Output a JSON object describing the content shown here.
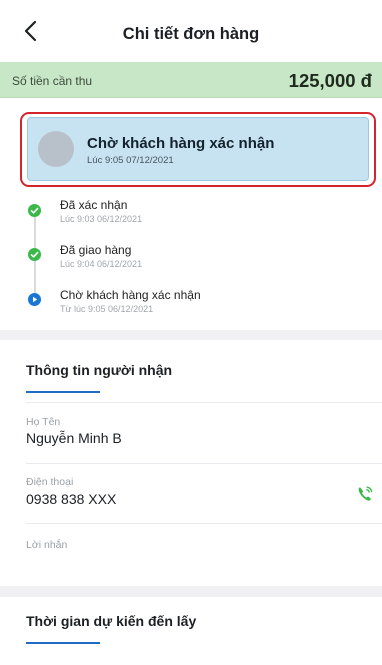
{
  "header": {
    "title": "Chi tiết đơn hàng"
  },
  "amount": {
    "label": "Số tiền cần thu",
    "value": "125,000 đ"
  },
  "current_status": {
    "title": "Chờ khách hàng xác nhận",
    "time": "Lúc 9:05 07/12/2021"
  },
  "timeline": [
    {
      "title": "Đã xác nhận",
      "time": "Lúc 9:03 06/12/2021",
      "status": "done"
    },
    {
      "title": "Đã giao hàng",
      "time": "Lúc 9:04 06/12/2021",
      "status": "done"
    },
    {
      "title": "Chờ khách hàng xác nhận",
      "time": "Từ lúc 9:05 06/12/2021",
      "status": "current"
    }
  ],
  "recipient": {
    "section_title": "Thông tin người nhận",
    "name_label": "Họ Tên",
    "name_value": "Nguyễn Minh B",
    "phone_label": "Điện thoại",
    "phone_value": "0938 838 XXX",
    "message_label": "Lời nhắn"
  },
  "pickup": {
    "section_title": "Thời gian dự kiến đến lấy"
  },
  "colors": {
    "done": "#3ab84a",
    "current": "#1877d4",
    "highlight": "#d4242d",
    "amount_bg": "#c8e7c6",
    "card_bg": "#c7e2f1"
  },
  "icons": {
    "back": "chevron-left-icon",
    "check": "check-icon",
    "phone": "phone-ringing-icon"
  }
}
